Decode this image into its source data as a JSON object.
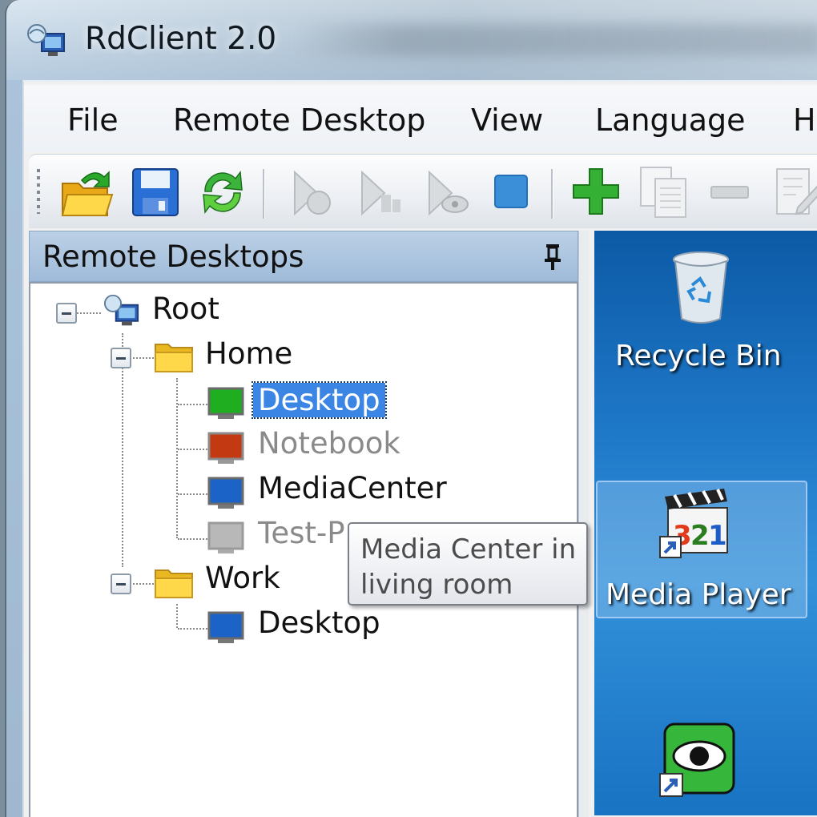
{
  "window": {
    "title": "RdClient 2.0"
  },
  "menu": [
    "File",
    "Remote Desktop",
    "View",
    "Language",
    "H"
  ],
  "toolbar": {
    "buttons": [
      "open-folder-icon",
      "save-icon",
      "refresh-icon",
      "connect-icon",
      "connect-all-icon",
      "view-icon",
      "stop-icon",
      "add-icon",
      "copy-icon",
      "remove-icon",
      "edit-icon"
    ]
  },
  "panel": {
    "title": "Remote Desktops"
  },
  "tree": {
    "root": "Root",
    "home": {
      "label": "Home",
      "items": [
        {
          "label": "Desktop",
          "color": "#1fae1f",
          "state": "selected"
        },
        {
          "label": "Notebook",
          "color": "#c33a12",
          "state": "disabled"
        },
        {
          "label": "MediaCenter",
          "color": "#1c63c8",
          "state": "normal"
        },
        {
          "label": "Test-P",
          "color": "#b8b8b8",
          "state": "disabled"
        }
      ]
    },
    "work": {
      "label": "Work",
      "items": [
        {
          "label": "Desktop",
          "color": "#1c63c8",
          "state": "normal"
        }
      ]
    }
  },
  "tooltip": {
    "line1": "Media Center in",
    "line2": "living room"
  },
  "desktop": {
    "icons": [
      {
        "label": "Recycle Bin",
        "icon": "recycle-bin-icon"
      },
      {
        "label": "Media Player",
        "icon": "media-player-icon"
      },
      {
        "label": "",
        "icon": "eye-icon"
      }
    ]
  }
}
